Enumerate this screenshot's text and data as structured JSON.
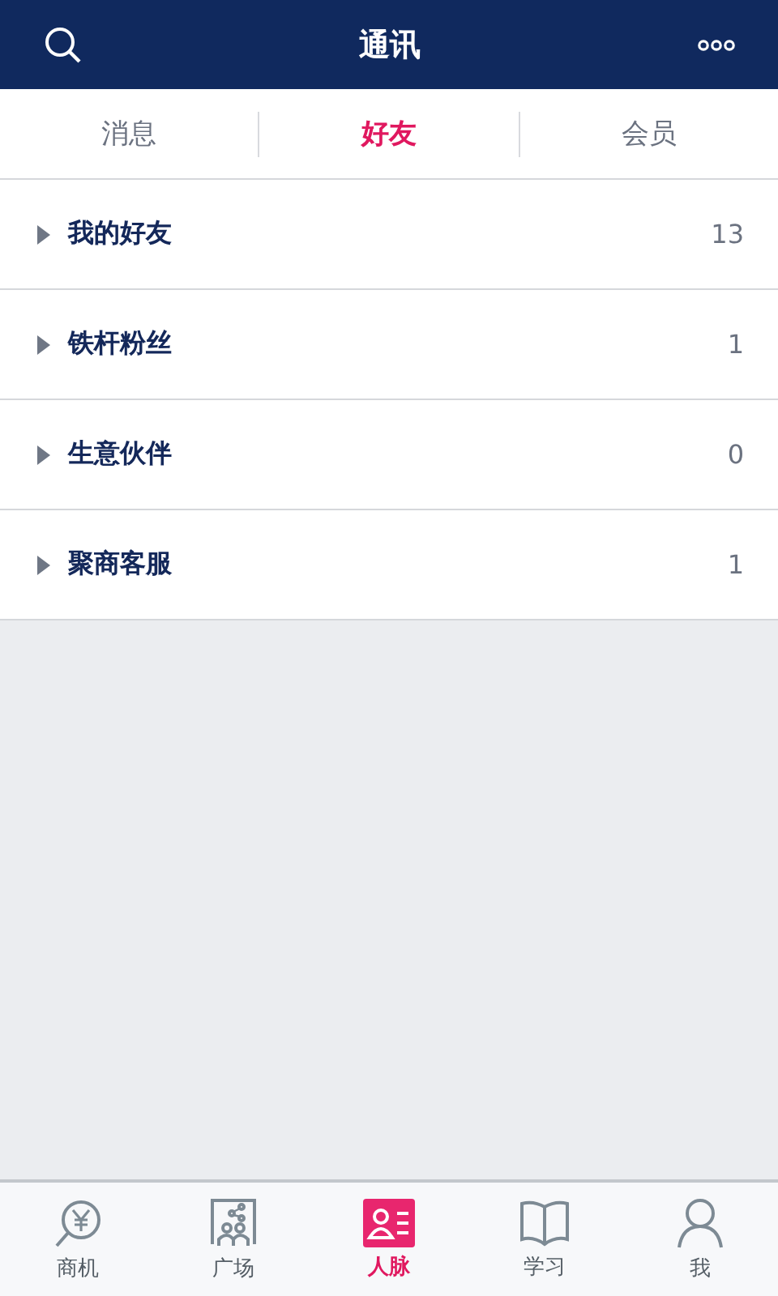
{
  "header": {
    "title": "通讯"
  },
  "tabs": [
    {
      "label": "消息",
      "selected": false
    },
    {
      "label": "好友",
      "selected": true
    },
    {
      "label": "会员",
      "selected": false
    }
  ],
  "groups": [
    {
      "name": "我的好友",
      "count": "13",
      "expanded": false
    },
    {
      "name": "铁杆粉丝",
      "count": "1",
      "expanded": false
    },
    {
      "name": "生意伙伴",
      "count": "0",
      "expanded": false
    },
    {
      "name": "聚商客服",
      "count": "1",
      "expanded": false
    }
  ],
  "nav": [
    {
      "label": "商机",
      "kind": "coin",
      "selected": false
    },
    {
      "label": "广场",
      "kind": "share",
      "selected": false
    },
    {
      "label": "人脉",
      "kind": "contact",
      "selected": true
    },
    {
      "label": "学习",
      "kind": "book",
      "selected": false
    },
    {
      "label": "我",
      "kind": "person",
      "selected": false
    }
  ]
}
